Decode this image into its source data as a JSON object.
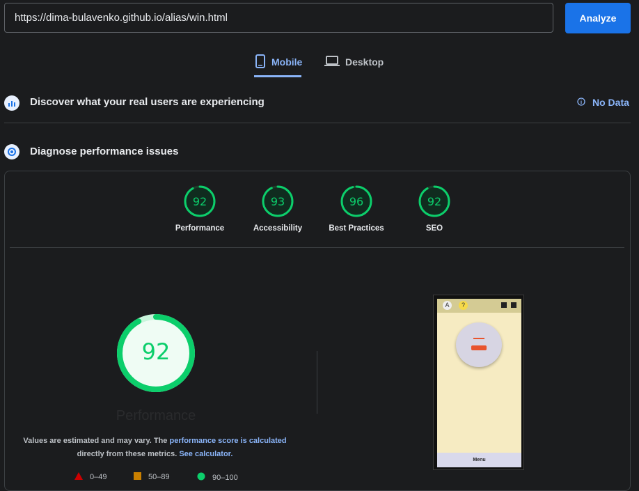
{
  "url_input": {
    "value": "https://dima-bulavenko.github.io/alias/win.html"
  },
  "analyze_label": "Analyze",
  "tabs": [
    {
      "label": "Mobile",
      "icon": "phone-icon",
      "active": true
    },
    {
      "label": "Desktop",
      "icon": "laptop-icon",
      "active": false
    }
  ],
  "field_section": {
    "title": "Discover what your real users are experiencing",
    "status": "No Data",
    "icon": "users-chart-icon"
  },
  "lab_section": {
    "title": "Diagnose performance issues",
    "icon": "lab-icon"
  },
  "scores": [
    {
      "label": "Performance",
      "value": 92
    },
    {
      "label": "Accessibility",
      "value": 93
    },
    {
      "label": "Best Practices",
      "value": 96
    },
    {
      "label": "SEO",
      "value": 92
    }
  ],
  "main_gauge": {
    "value": 92,
    "label": "Performance"
  },
  "note": {
    "pre": "Values are estimated and may vary. The ",
    "link1": "performance score is calculated",
    "mid": "directly from these metrics. ",
    "link2": "See calculator."
  },
  "legend": [
    {
      "range": "0–49",
      "color": "#cc0000",
      "shape": "triangle"
    },
    {
      "range": "50–89",
      "color": "#c97f00",
      "shape": "square"
    },
    {
      "range": "90–100",
      "color": "#0cce6b",
      "shape": "circle"
    }
  ],
  "phone_preview": {
    "menu_label": "Menu",
    "top_badge": "A",
    "help_badge": "?"
  },
  "colors": {
    "accent": "#8ab4f8",
    "button": "#1a73e8",
    "good": "#0cce6b"
  }
}
